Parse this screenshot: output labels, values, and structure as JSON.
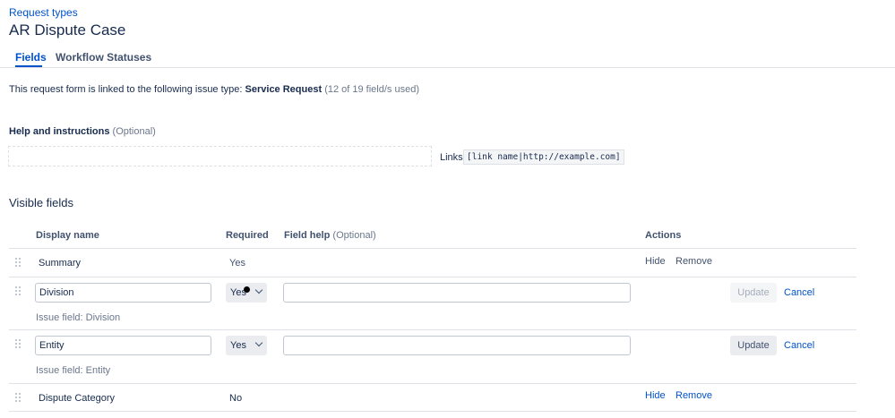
{
  "breadcrumb": "Request types",
  "page_title": "AR Dispute Case",
  "tabs": [
    {
      "label": "Fields",
      "active": true
    },
    {
      "label": "Workflow Statuses",
      "active": false
    }
  ],
  "description": {
    "prefix": "This request form is linked to the following issue type:",
    "issue_type": "Service Request",
    "usage": "(12 of 19 field/s used)"
  },
  "help": {
    "label": "Help and instructions",
    "optional": "(Optional)",
    "value": "",
    "links_label": "Links",
    "links_example": "[link name|http://example.com]"
  },
  "visible_fields": {
    "title": "Visible fields",
    "columns": {
      "display_name": "Display name",
      "required": "Required",
      "field_help": "Field help",
      "field_help_optional": "(Optional)",
      "actions": "Actions"
    },
    "rows": [
      {
        "name": "Summary",
        "required": "Yes",
        "hide": "Hide",
        "remove": "Remove"
      },
      {
        "name": "Division",
        "required": "Yes",
        "help": "",
        "issue_field": "Issue field: Division",
        "update": "Update",
        "cancel": "Cancel"
      },
      {
        "name": "Entity",
        "required": "Yes",
        "help": "",
        "issue_field": "Issue field: Entity",
        "update": "Update",
        "cancel": "Cancel"
      },
      {
        "name": "Dispute Category",
        "required": "No",
        "hide": "Hide",
        "remove": "Remove"
      }
    ]
  },
  "colors": {
    "accent": "#0052cc",
    "text": "#172b4d",
    "muted": "#6b778c",
    "border": "#dfe1e6"
  }
}
